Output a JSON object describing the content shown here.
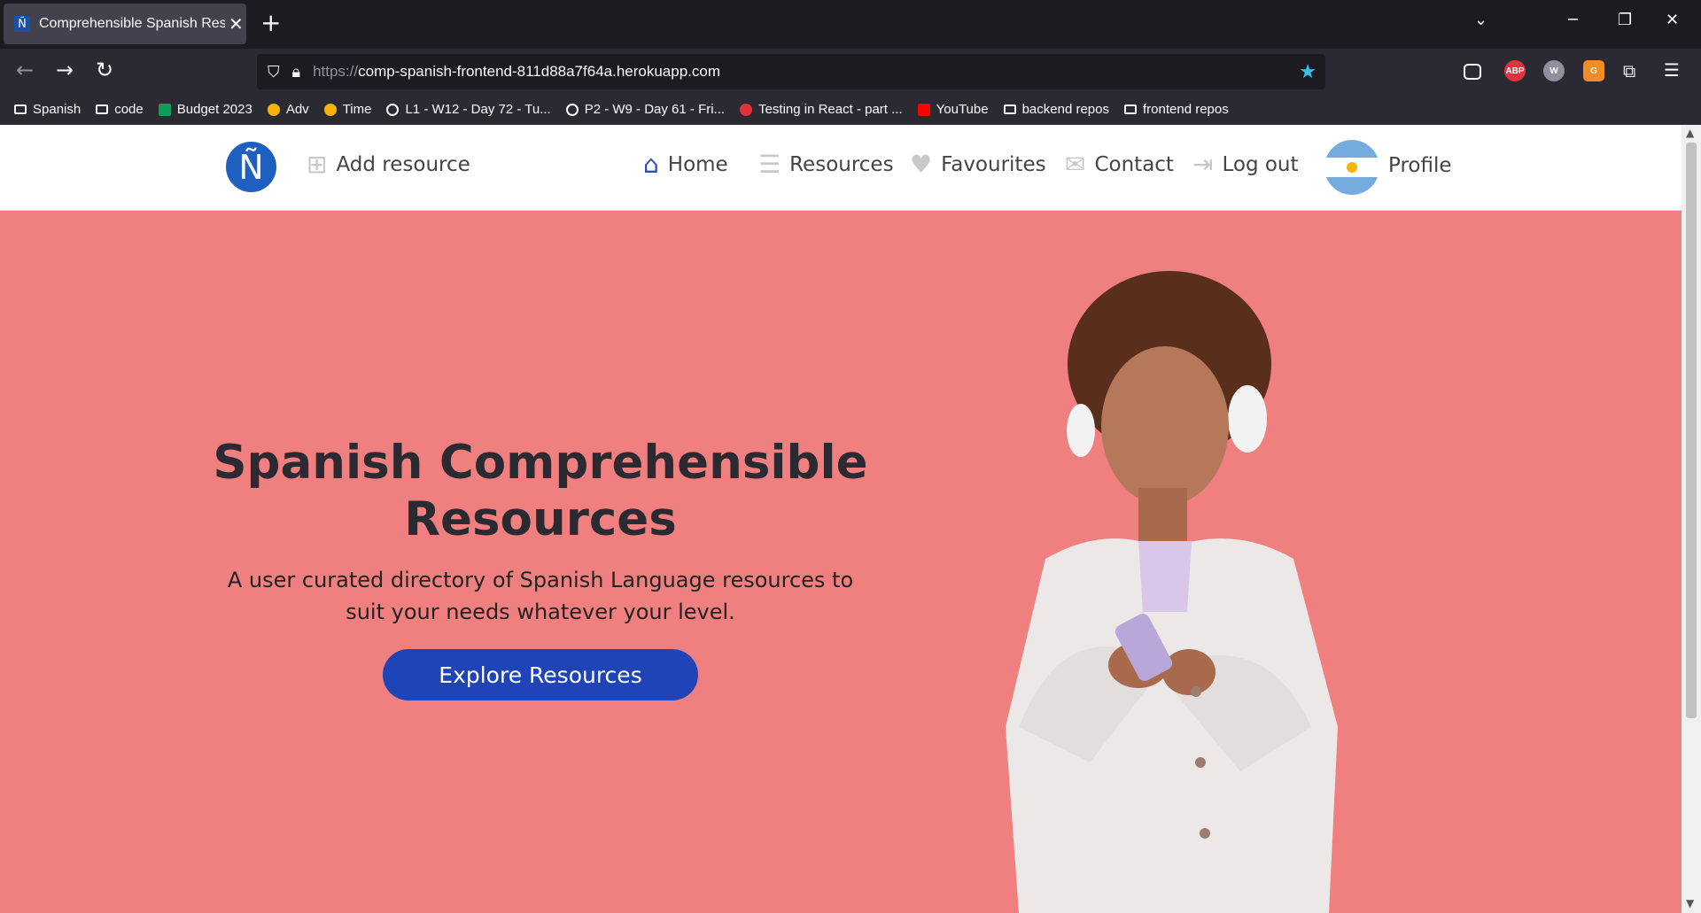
{
  "browser": {
    "tab_title": "Comprehensible Spanish Resou",
    "tab_favicon": "Ñ",
    "url_protocol": "https://",
    "url_host": "comp-spanish-frontend-811d88a7f64a.herokuapp.com",
    "bookmarks": [
      {
        "label": "Spanish",
        "icon": "folder-icon"
      },
      {
        "label": "code",
        "icon": "folder-icon"
      },
      {
        "label": "Budget 2023",
        "icon": "sheets-icon"
      },
      {
        "label": "Adv",
        "icon": "clock-icon"
      },
      {
        "label": "Time",
        "icon": "clock-icon"
      },
      {
        "label": "L1 - W12 - Day 72 - Tu...",
        "icon": "site-icon"
      },
      {
        "label": "P2 - W9 - Day 61 - Fri...",
        "icon": "globe-icon"
      },
      {
        "label": "Testing in React - part ...",
        "icon": "circle-icon"
      },
      {
        "label": "YouTube",
        "icon": "youtube-icon"
      },
      {
        "label": "backend repos",
        "icon": "folder-icon"
      },
      {
        "label": "frontend repos",
        "icon": "folder-icon"
      }
    ]
  },
  "site": {
    "logo": "Ñ",
    "nav": {
      "add_resource": "Add resource",
      "home": "Home",
      "resources": "Resources",
      "favourites": "Favourites",
      "contact": "Contact",
      "logout": "Log out",
      "profile": "Profile"
    },
    "hero": {
      "title": "Spanish Comprehensible Resources",
      "subtitle": "A user curated directory of Spanish Language resources to suit your needs whatever your level.",
      "cta": "Explore Resources"
    },
    "colors": {
      "hero_bg": "#f08080",
      "cta_bg": "#1f44b8",
      "home_icon": "#2b4fc2"
    }
  }
}
